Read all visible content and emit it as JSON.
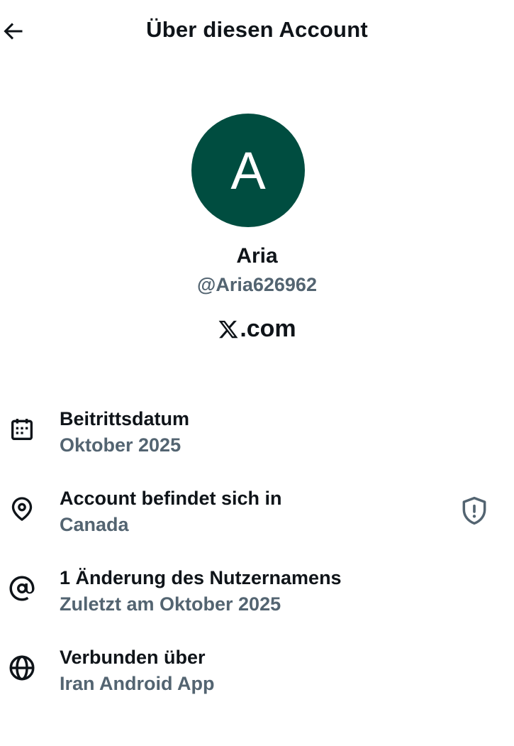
{
  "header": {
    "title": "Über diesen Account"
  },
  "profile": {
    "avatar_initial": "A",
    "avatar_color": "#004d40",
    "display_name": "Aria",
    "handle": "@Aria626962",
    "site_suffix": ".com",
    "site_logo": "x-logo"
  },
  "info": {
    "joined": {
      "icon": "calendar-icon",
      "label": "Beitrittsdatum",
      "value": "Oktober 2025"
    },
    "location": {
      "icon": "location-pin-icon",
      "label": "Account befindet sich in",
      "value": "Canada",
      "action_icon": "shield-icon"
    },
    "username_changes": {
      "icon": "at-sign-icon",
      "label": "1 Änderung des Nutzernamens",
      "value": "Zuletzt am Oktober 2025"
    },
    "connected_via": {
      "icon": "globe-icon",
      "label": "Verbunden über",
      "value": "Iran Android App"
    }
  },
  "colors": {
    "primary_text": "#0f1419",
    "secondary_text": "#536471"
  }
}
